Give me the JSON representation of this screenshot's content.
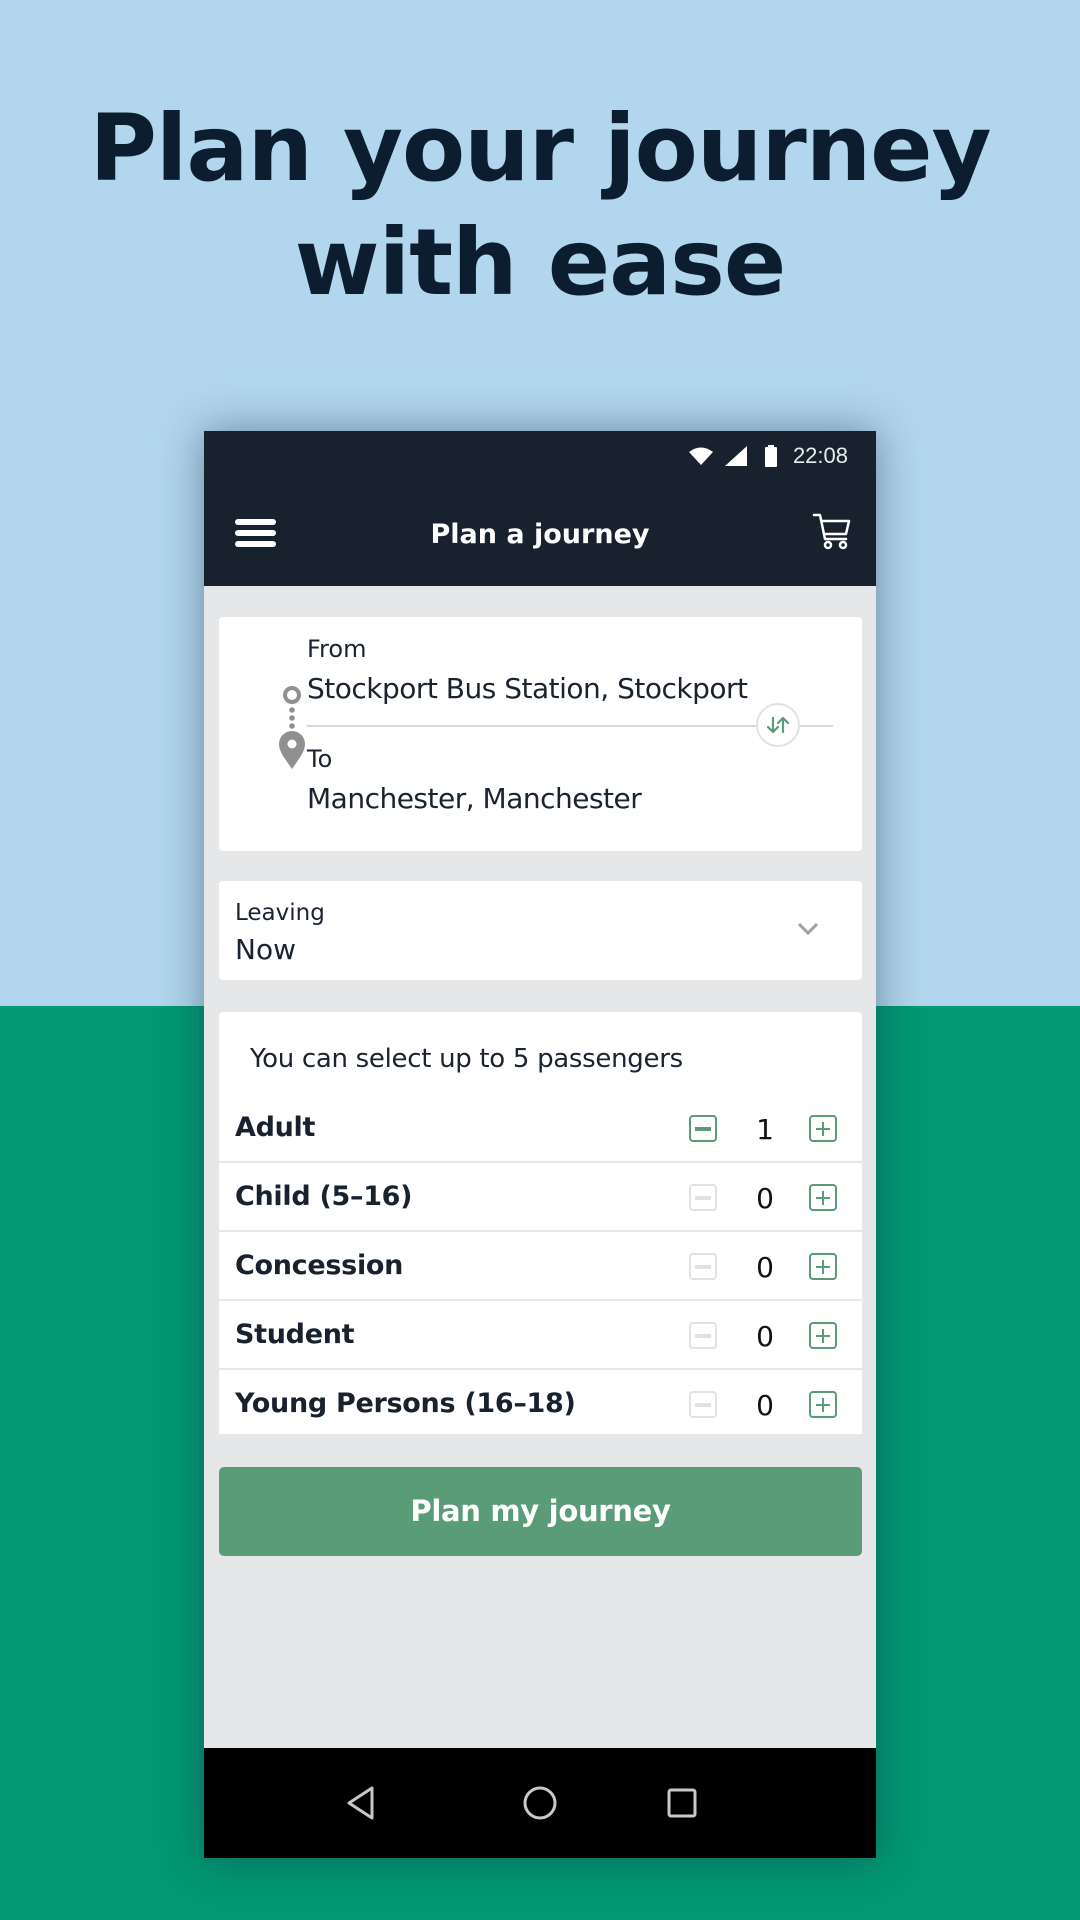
{
  "promo": {
    "headline_line1": "Plan your journey",
    "headline_line2": "with ease",
    "colors": {
      "top_background": "#b1d6ed",
      "bottom_background": "#029873",
      "headline": "#0b1d2e"
    }
  },
  "status_bar": {
    "time": "22:08",
    "icons": [
      "wifi-icon",
      "cellular-signal-icon",
      "battery-icon"
    ]
  },
  "app_bar": {
    "title": "Plan a journey",
    "left_icon": "hamburger-menu-icon",
    "right_icon": "shopping-cart-icon",
    "background": "#18222f"
  },
  "route": {
    "from_label": "From",
    "from_value": "Stockport Bus Station, Stockport",
    "to_label": "To",
    "to_value": "Manchester, Manchester",
    "swap_icon": "swap-arrows-icon"
  },
  "leaving": {
    "label": "Leaving",
    "value": "Now",
    "icon": "chevron-down-icon"
  },
  "passengers": {
    "note": "You can select up to 5 passengers",
    "max": 5,
    "rows": [
      {
        "label": "Adult",
        "count": "1",
        "minus_enabled": true,
        "plus_enabled": true
      },
      {
        "label": "Child (5–16)",
        "count": "0",
        "minus_enabled": false,
        "plus_enabled": true
      },
      {
        "label": "Concession",
        "count": "0",
        "minus_enabled": false,
        "plus_enabled": true
      },
      {
        "label": "Student",
        "count": "0",
        "minus_enabled": false,
        "plus_enabled": true
      },
      {
        "label": "Young Persons (16–18)",
        "count": "0",
        "minus_enabled": false,
        "plus_enabled": true
      }
    ]
  },
  "actions": {
    "plan_button": "Plan my journey",
    "accent": "#5a9b78"
  },
  "nav_bar": {
    "buttons": [
      "back-icon",
      "home-icon",
      "recents-icon"
    ]
  }
}
